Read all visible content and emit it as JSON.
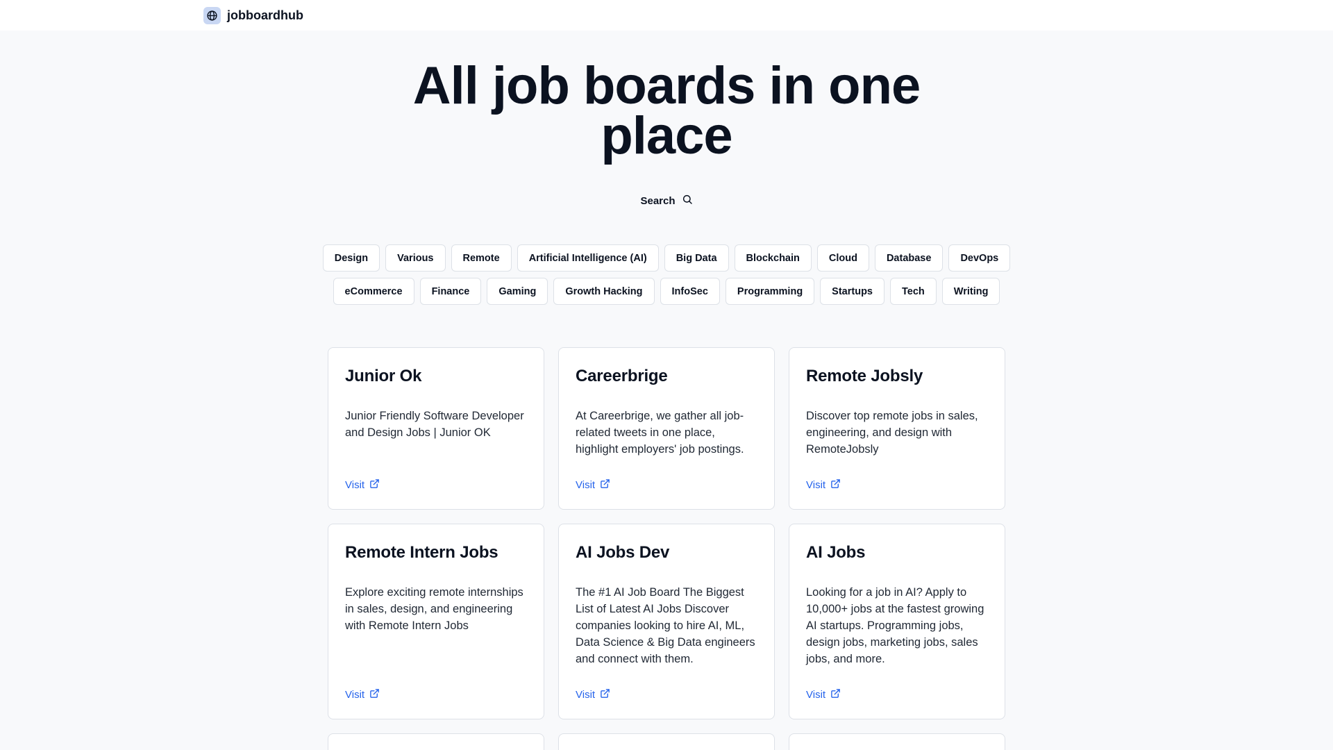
{
  "header": {
    "brand": "jobboardhub",
    "logo_icon": "globe-icon"
  },
  "hero": {
    "line1": "All job boards in one",
    "line2": "place"
  },
  "search": {
    "label": "Search",
    "icon": "search-icon"
  },
  "tags_row1": [
    "Design",
    "Various",
    "Remote",
    "Artificial Intelligence (AI)",
    "Big Data",
    "Blockchain",
    "Cloud",
    "Database",
    "DevOps"
  ],
  "tags_row2": [
    "eCommerce",
    "Finance",
    "Gaming",
    "Growth Hacking",
    "InfoSec",
    "Programming",
    "Startups",
    "Tech",
    "Writing"
  ],
  "cards": [
    {
      "title": "Junior Ok",
      "description": "Junior Friendly Software Developer and Design Jobs | Junior OK",
      "visit": "Visit"
    },
    {
      "title": "Careerbrige",
      "description": "At Careerbrige, we gather all job-related tweets in one place, highlight employers' job postings.",
      "visit": "Visit"
    },
    {
      "title": "Remote Jobsly",
      "description": "Discover top remote jobs in sales, engineering, and design with RemoteJobsly",
      "visit": "Visit"
    },
    {
      "title": "Remote Intern Jobs",
      "description": "Explore exciting remote internships in sales, design, and engineering with Remote Intern Jobs",
      "visit": "Visit"
    },
    {
      "title": "AI Jobs Dev",
      "description": "The #1 AI Job Board The Biggest List of Latest AI Jobs Discover companies looking to hire AI, ML, Data Science & Big Data engineers and connect with them.",
      "visit": "Visit"
    },
    {
      "title": "AI Jobs",
      "description": "Looking for a job in AI? Apply to 10,000+ jobs at the fastest growing AI startups. Programming jobs, design jobs, marketing jobs, sales jobs, and more.",
      "visit": "Visit"
    }
  ],
  "colors": {
    "accent": "#2563eb",
    "background": "#f8f9fb",
    "text": "#0b1220"
  }
}
